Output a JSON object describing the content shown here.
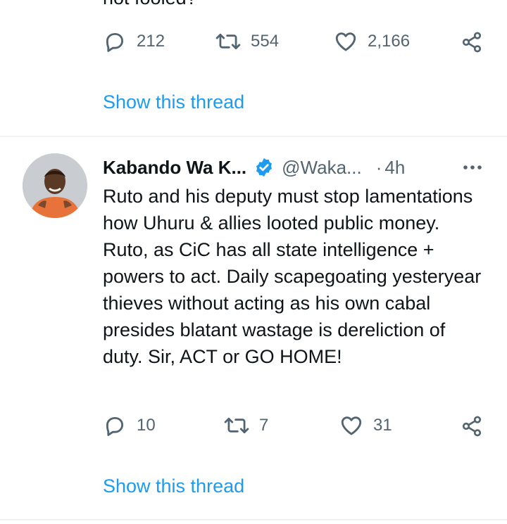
{
  "prev_tweet": {
    "text_cut": "not fooled?",
    "replies": "212",
    "retweets": "554",
    "likes": "2,166",
    "show_thread": "Show this thread"
  },
  "tweet": {
    "name": "Kabando Wa K...",
    "handle": "@Waka...",
    "separator": "·",
    "time": "4h",
    "text": "Ruto and his deputy must stop lamentations how Uhuru & allies looted public money. Ruto, as CiC has all state intelligence + powers to act. Daily scapegoating yesteryear thieves without acting as his own cabal presides blatant wastage is dereliction of duty. Sir,  ACT or GO HOME!",
    "replies": "10",
    "retweets": "7",
    "likes": "31",
    "show_thread": "Show this thread"
  },
  "icons": {
    "reply": "reply-icon",
    "retweet": "retweet-icon",
    "like": "heart-icon",
    "share": "share-icon",
    "verified": "verified-badge-icon",
    "more": "more-icon"
  },
  "colors": {
    "link": "#1d9bf0",
    "muted": "#536471",
    "text": "#0f1419",
    "divider": "#eff3f4"
  }
}
